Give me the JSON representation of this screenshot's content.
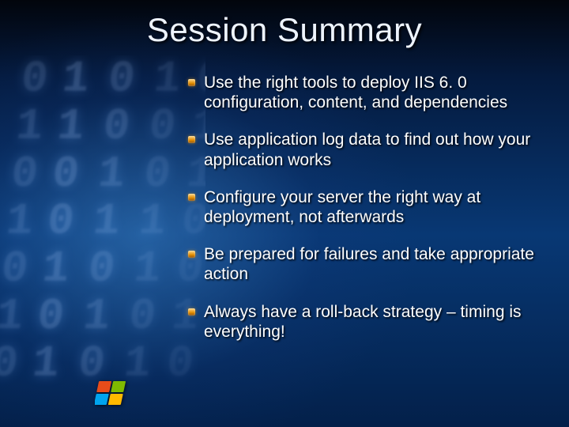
{
  "title": "Session Summary",
  "bullets": [
    "Use the right tools to deploy IIS 6. 0 configuration, content, and dependencies",
    "Use application log data to find out how your application works",
    "Configure your server the right way at deployment, not afterwards",
    "Be prepared for failures and take appropriate action",
    "Always have a roll-back strategy – timing is everything!"
  ]
}
